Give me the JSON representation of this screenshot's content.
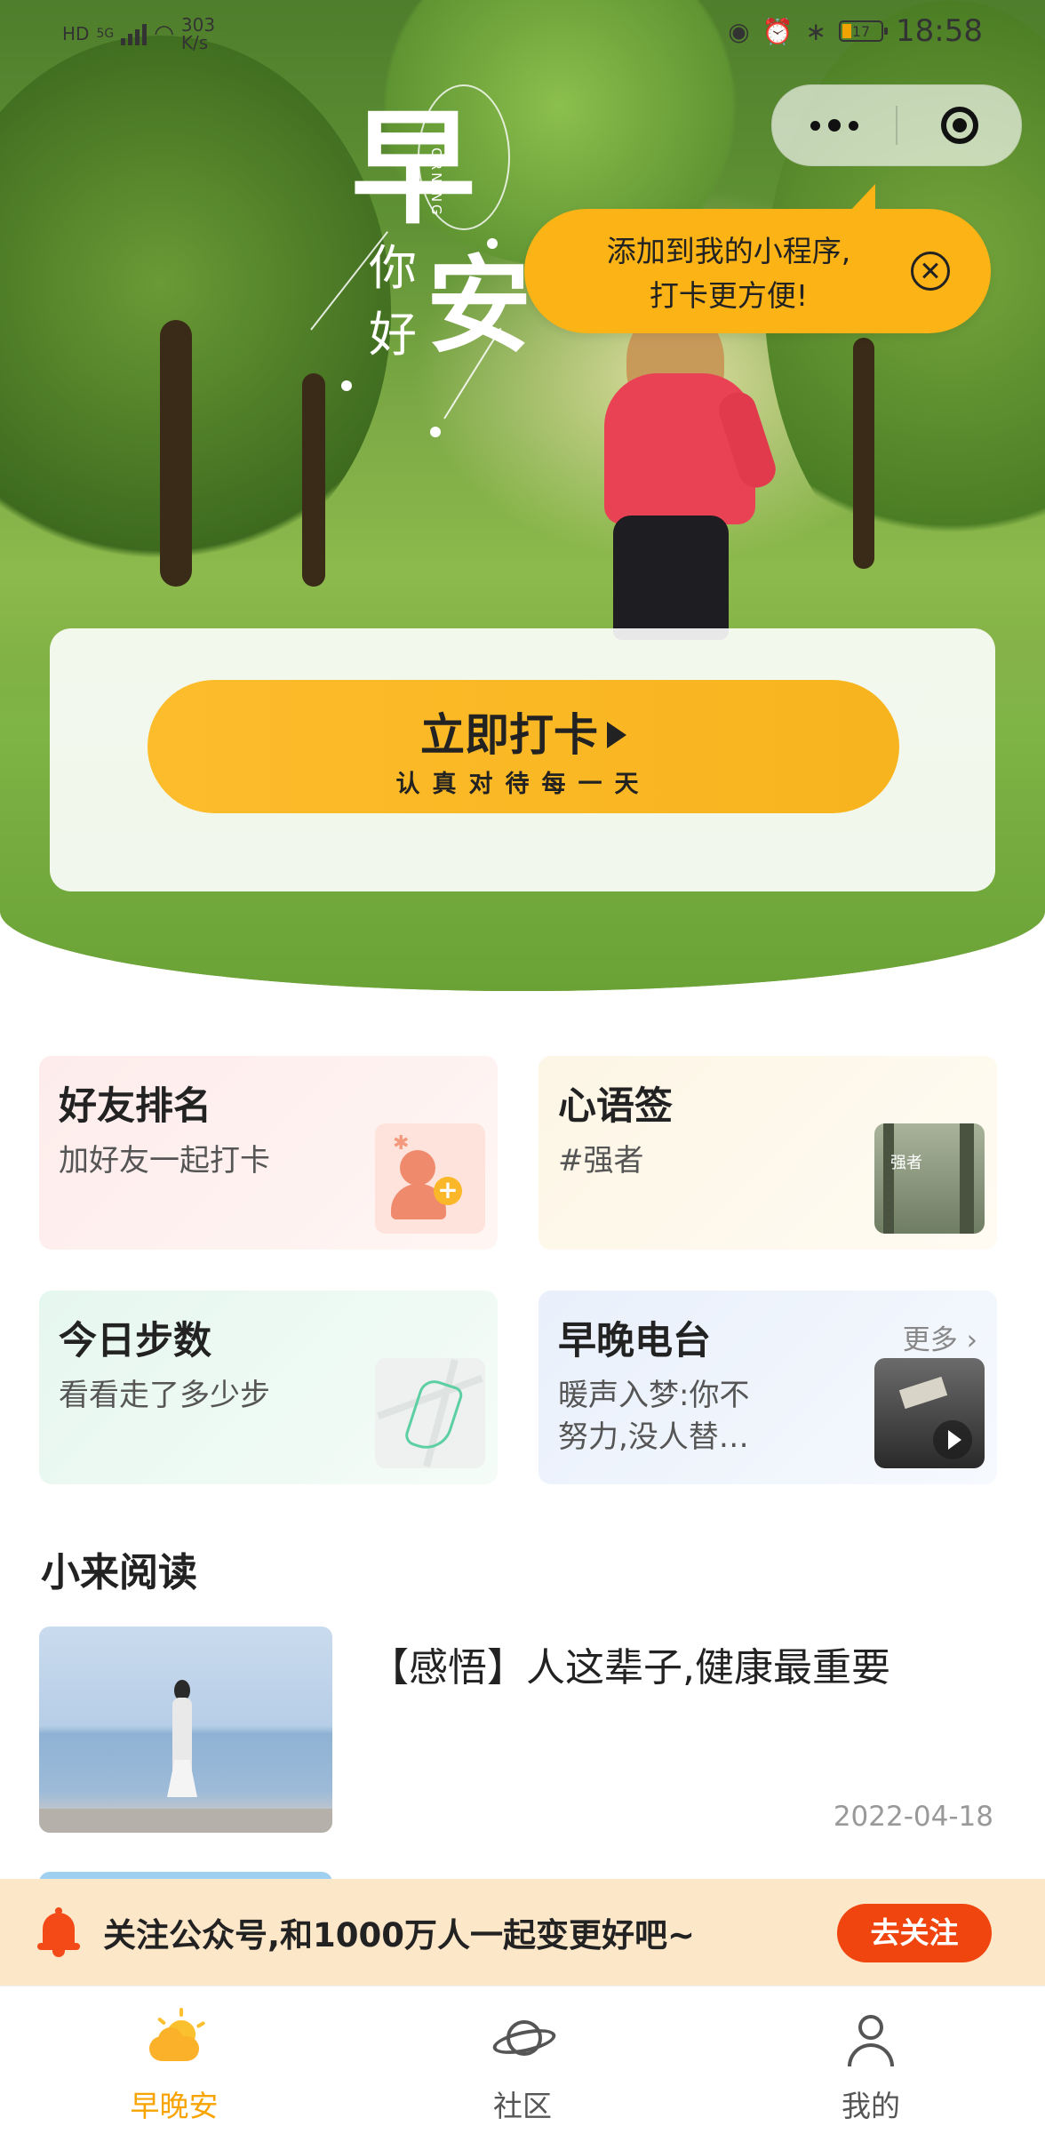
{
  "status_bar": {
    "left_labels": [
      "HD",
      "5G",
      "303",
      "K/s"
    ],
    "battery": "17",
    "time": "18:58"
  },
  "hero": {
    "calligraphy": {
      "zao": "早",
      "an": "安",
      "ni": "你",
      "hao": "好",
      "morning": "MORNING"
    }
  },
  "capsule": {
    "more_icon": "more-dots-icon",
    "close_icon": "target-circle-icon"
  },
  "tooltip": {
    "line1": "添加到我的小程序,",
    "line2": "打卡更方便!",
    "close_icon": "close-circle-icon"
  },
  "checkin": {
    "label": "立即打卡",
    "subtitle": "认真对待每一天"
  },
  "cards": {
    "friends": {
      "title": "好友排名",
      "subtitle": "加好友一起打卡"
    },
    "heart": {
      "title": "心语签",
      "subtitle": "#强者",
      "thumb_text": "强者"
    },
    "steps": {
      "title": "今日步数",
      "subtitle": "看看走了多少步"
    },
    "radio": {
      "title": "早晚电台",
      "more": "更多",
      "subtitle_line1": "暖声入梦:你不",
      "subtitle_line2": "努力,没人替…"
    }
  },
  "reading": {
    "section_title": "小来阅读",
    "articles": [
      {
        "title": "【感悟】人这辈子,健康最重要",
        "date": "2022-04-18"
      }
    ]
  },
  "follow_banner": {
    "text": "关注公众号,和1000万人一起变更好吧~",
    "button": "去关注"
  },
  "tabbar": {
    "tabs": [
      {
        "label": "早晚安",
        "icon": "sun-cloud-icon",
        "active": true
      },
      {
        "label": "社区",
        "icon": "planet-icon",
        "active": false
      },
      {
        "label": "我的",
        "icon": "person-icon",
        "active": false
      }
    ],
    "active_color": "#f8a400"
  },
  "colors": {
    "accent": "#fbb316",
    "follow_button": "#f1450f",
    "follow_banner_bg": "#fde7c9"
  }
}
